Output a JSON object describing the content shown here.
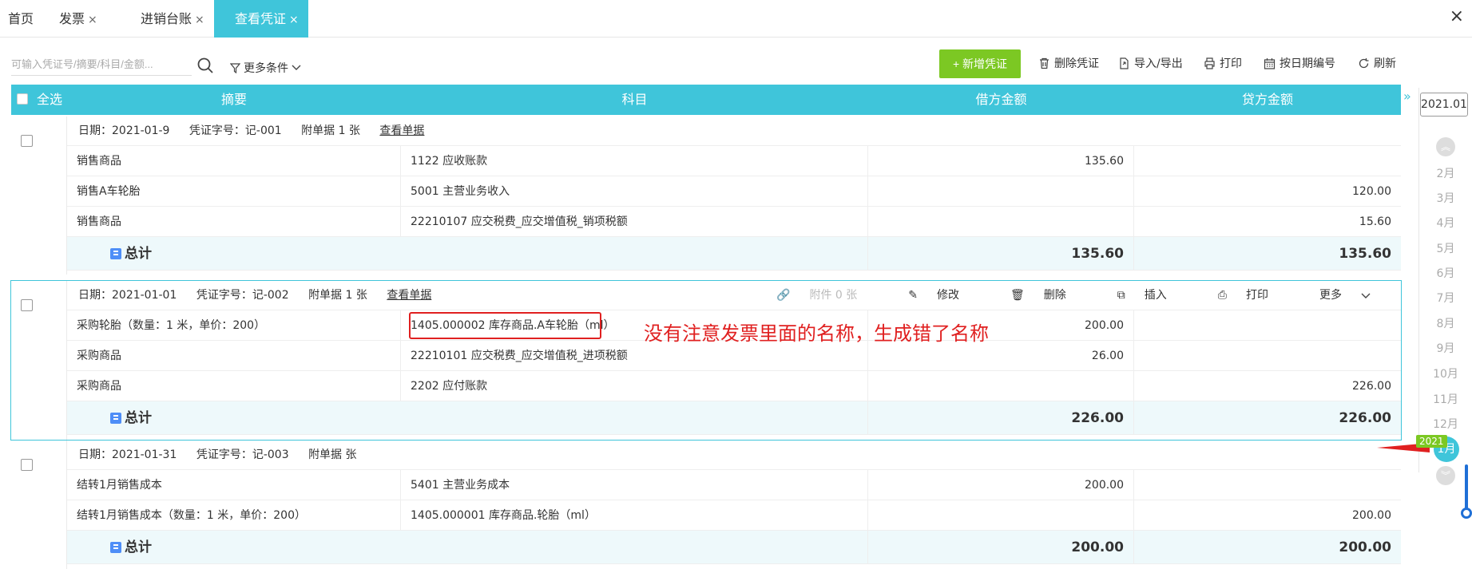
{
  "tabs": [
    {
      "label": "首页",
      "closable": false
    },
    {
      "label": "发票",
      "closable": true
    },
    {
      "label": "进销台账",
      "closable": true
    },
    {
      "label": "查看凭证",
      "closable": true,
      "active": true
    }
  ],
  "close_glyph": "×",
  "toolbar": {
    "search_placeholder": "可输入凭证号/摘要/科目/金额...",
    "more_conditions": "更多条件",
    "new_voucher": "+ 新增凭证",
    "delete_voucher": "删除凭证",
    "import_export": "导入/导出",
    "print": "打印",
    "renumber_by_date": "按日期编号",
    "refresh": "刷新"
  },
  "table": {
    "select_all": "全选",
    "columns": [
      "摘要",
      "科目",
      "借方金额",
      "贷方金额"
    ]
  },
  "vouchers": [
    {
      "date": "日期：2021-01-9",
      "number": "凭证字号：记-001",
      "attachments": "附单据 1 张",
      "view_docs": "查看单据",
      "rows": [
        {
          "summary": "销售商品",
          "account": "1122 应收账款",
          "debit": "135.60",
          "credit": ""
        },
        {
          "summary": "销售A车轮胎",
          "account": "5001 主营业务收入",
          "debit": "",
          "credit": "120.00"
        },
        {
          "summary": "销售商品",
          "account": "22210107 应交税费_应交增值税_销项税额",
          "debit": "",
          "credit": "15.60"
        }
      ],
      "total_label": "总计",
      "total_debit": "135.60",
      "total_credit": "135.60"
    },
    {
      "date": "日期：2021-01-01",
      "number": "凭证字号：记-002",
      "attachments": "附单据 1 张",
      "view_docs": "查看单据",
      "actions": {
        "attachment": "附件 0 张",
        "edit": "修改",
        "delete": "删除",
        "insert": "插入",
        "print": "打印",
        "more": "更多"
      },
      "rows": [
        {
          "summary": "采购轮胎（数量：1 米，单价：200）",
          "account": "1405.000002  库存商品.A车轮胎（ml）",
          "debit": "200.00",
          "credit": ""
        },
        {
          "summary": "采购商品",
          "account": "22210101 应交税费_应交增值税_进项税额",
          "debit": "26.00",
          "credit": ""
        },
        {
          "summary": "采购商品",
          "account": "2202 应付账款",
          "debit": "",
          "credit": "226.00"
        }
      ],
      "total_label": "总计",
      "total_debit": "226.00",
      "total_credit": "226.00"
    },
    {
      "date": "日期：2021-01-31",
      "number": "凭证字号：记-003",
      "attachments": "附单据  张",
      "rows": [
        {
          "summary": "结转1月销售成本",
          "account": "5401 主营业务成本",
          "debit": "200.00",
          "credit": ""
        },
        {
          "summary": "结转1月销售成本（数量：1 米，单价：200）",
          "account": "1405.000001  库存商品.轮胎（ml）",
          "debit": "",
          "credit": "200.00"
        }
      ],
      "total_label": "总计",
      "total_debit": "200.00",
      "total_credit": "200.00"
    }
  ],
  "annotation": "没有注意发票里面的名称，生成错了名称",
  "side": {
    "period": "2021.01",
    "months": [
      "2月",
      "3月",
      "4月",
      "5月",
      "6月",
      "7月",
      "8月",
      "9月",
      "10月",
      "11月",
      "12月"
    ],
    "current_year": "2021",
    "current_month": "1月",
    "expand_glyph": "»"
  },
  "colors": {
    "header": "#3fc5da",
    "primary_button": "#7cc823",
    "annotation": "#e02020"
  }
}
